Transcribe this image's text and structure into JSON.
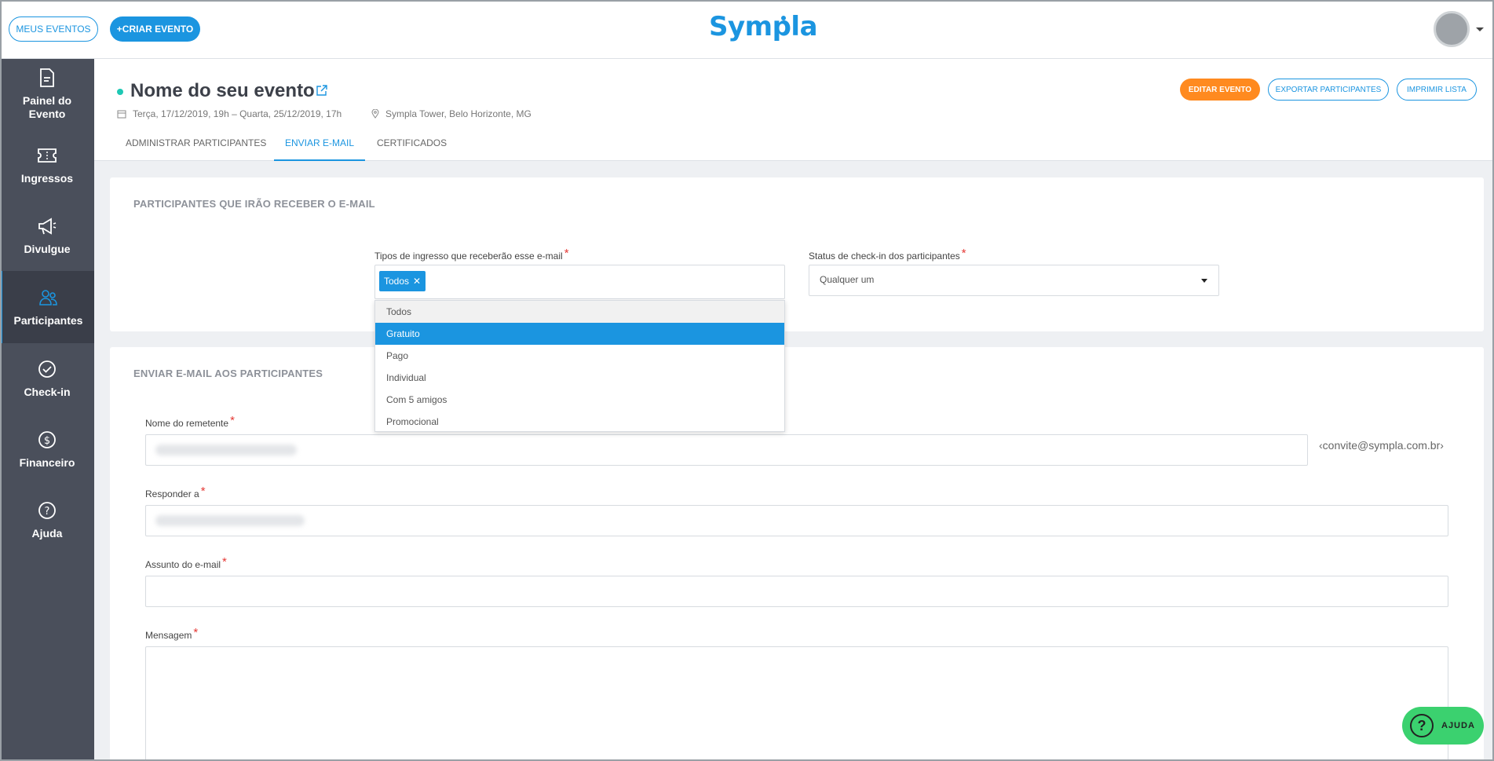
{
  "topbar": {
    "my_events": "MEUS EVENTOS",
    "create_event": "+CRIAR EVENTO",
    "logo": "Sympla"
  },
  "sidebar": {
    "items": [
      {
        "label": "Painel do Evento",
        "icon": "document-icon"
      },
      {
        "label": "Ingressos",
        "icon": "ticket-icon"
      },
      {
        "label": "Divulgue",
        "icon": "megaphone-icon"
      },
      {
        "label": "Participantes",
        "icon": "people-icon"
      },
      {
        "label": "Check-in",
        "icon": "check-circle-icon"
      },
      {
        "label": "Financeiro",
        "icon": "dollar-icon"
      },
      {
        "label": "Ajuda",
        "icon": "help-icon"
      }
    ],
    "active": "Participantes"
  },
  "event": {
    "title": "Nome do seu evento",
    "date": "Terça, 17/12/2019, 19h – Quarta, 25/12/2019, 17h",
    "location": "Sympla Tower, Belo Horizonte, MG",
    "edit_button": "EDITAR EVENTO",
    "export_button": "EXPORTAR PARTICIPANTES",
    "print_button": "IMPRIMIR LISTA",
    "tabs": [
      {
        "label": "ADMINISTRAR PARTICIPANTES"
      },
      {
        "label": "ENVIAR E-MAIL"
      },
      {
        "label": "CERTIFICADOS"
      }
    ],
    "active_tab": "ENVIAR E-MAIL"
  },
  "recipients": {
    "title": "PARTICIPANTES QUE IRÃO RECEBER O E-MAIL",
    "ticket_types_label": "Tipos de ingresso que receberão esse e-mail",
    "selected_tag": "Todos",
    "checkin_label": "Status de check-in dos participantes",
    "checkin_value": "Qualquer um",
    "dropdown_options": [
      "Todos",
      "Gratuito",
      "Pago",
      "Individual",
      "Com 5 amigos",
      "Promocional"
    ],
    "highlighted_option": "Gratuito"
  },
  "email_form": {
    "title": "ENVIAR E-MAIL AOS PARTICIPANTES",
    "sender_label": "Nome do remetente",
    "sender_suffix": "‹convite@sympla.com.br›",
    "reply_label": "Responder a",
    "subject_label": "Assunto do e-mail",
    "message_label": "Mensagem"
  },
  "help": {
    "label": "AJUDA"
  },
  "colors": {
    "brand": "#1b95e0",
    "orange": "#ff8a1f",
    "sidebar": "#4a4f5b",
    "help": "#3bd16f"
  }
}
